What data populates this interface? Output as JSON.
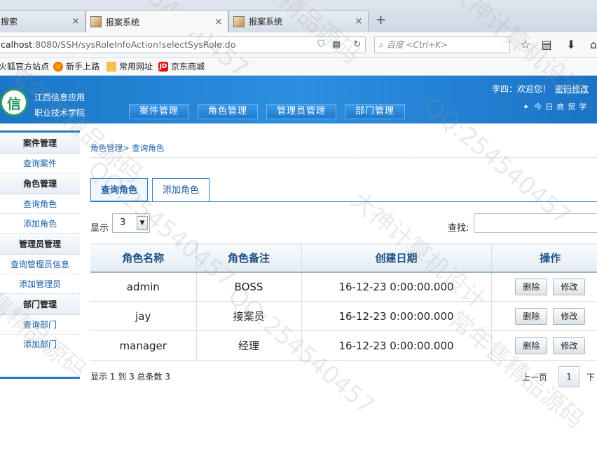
{
  "browser": {
    "tabs": [
      {
        "label": "搜索",
        "close": "×"
      },
      {
        "label": "报案系统",
        "close": "×"
      },
      {
        "label": "报案系统",
        "close": "×"
      }
    ],
    "new_tab": "+",
    "url_host": "calhost",
    "url_rest": ":8080/SSH/sysRoleInfoAction!selectSysRole.do",
    "search_placeholder": "百度 <Ctrl+K>",
    "bookmarks": [
      "火狐官方站点",
      "新手上路",
      "常用网址",
      "京东商城"
    ]
  },
  "header": {
    "school_line1": "江西信息应用",
    "school_line2": "职业技术学院",
    "nav": [
      "案件管理",
      "角色管理",
      "管理员管理",
      "部门管理"
    ],
    "welcome": "李四：欢迎您！",
    "change_password": "密码修改",
    "slogan": "今日商贸学"
  },
  "sidebar": {
    "groups": [
      {
        "title": "案件管理",
        "items": [
          "查询案件"
        ]
      },
      {
        "title": "角色管理",
        "items": [
          "查询角色",
          "添加角色"
        ]
      },
      {
        "title": "管理员管理",
        "items": [
          "查询管理员信息",
          "添加管理员"
        ]
      },
      {
        "title": "部门管理",
        "items": [
          "查询部门",
          "添加部门"
        ]
      }
    ]
  },
  "main": {
    "breadcrumb": "角色管理> 查询角色",
    "tabs": [
      "查询角色",
      "添加角色"
    ],
    "show_label": "显示",
    "page_size": "3",
    "find_label": "查找:",
    "columns": [
      "角色名称",
      "角色备注",
      "创建日期",
      "操作"
    ],
    "rows": [
      {
        "name": "admin",
        "note": "BOSS",
        "date": "16-12-23 0:00:00.000"
      },
      {
        "name": "jay",
        "note": "接案员",
        "date": "16-12-23 0:00:00.000"
      },
      {
        "name": "manager",
        "note": "经理",
        "date": "16-12-23 0:00:00.000"
      }
    ],
    "delete_label": "删除",
    "edit_label": "修改",
    "summary": "显示 1 到 3 总条数 3",
    "prev_label": "上一页",
    "current_page": "1",
    "next_label": "下"
  },
  "watermarks": [
    "QQ:254540457",
    "大神计算机设计",
    "常年售精品源码"
  ]
}
